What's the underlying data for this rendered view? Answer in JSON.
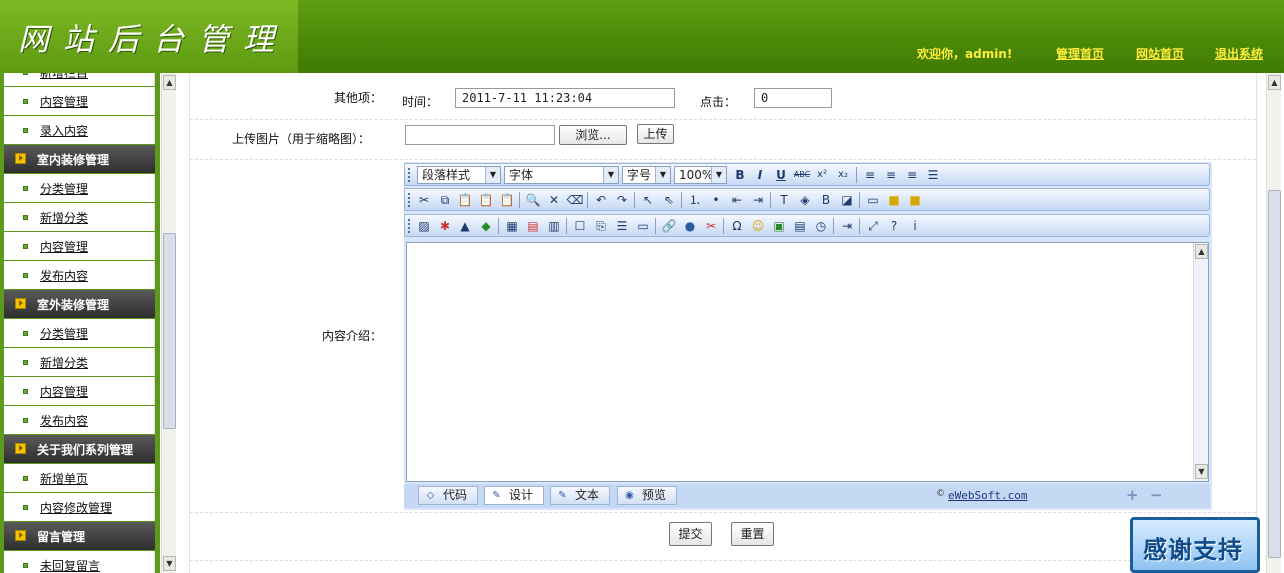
{
  "header": {
    "title": "网站后台管理",
    "welcome": "欢迎你，admin!",
    "links": [
      "管理首页",
      "网站首页",
      "退出系统"
    ]
  },
  "sidebar": {
    "items": [
      {
        "type": "item",
        "label": "新增栏目"
      },
      {
        "type": "item",
        "label": "内容管理"
      },
      {
        "type": "item",
        "label": "录入内容"
      },
      {
        "type": "head",
        "label": "室内装修管理"
      },
      {
        "type": "item",
        "label": "分类管理"
      },
      {
        "type": "item",
        "label": "新增分类"
      },
      {
        "type": "item",
        "label": "内容管理"
      },
      {
        "type": "item",
        "label": "发布内容"
      },
      {
        "type": "head",
        "label": "室外装修管理"
      },
      {
        "type": "item",
        "label": "分类管理"
      },
      {
        "type": "item",
        "label": "新增分类"
      },
      {
        "type": "item",
        "label": "内容管理"
      },
      {
        "type": "item",
        "label": "发布内容"
      },
      {
        "type": "head",
        "label": "关于我们系列管理"
      },
      {
        "type": "item",
        "label": "新增单页"
      },
      {
        "type": "item",
        "label": "内容修改管理"
      },
      {
        "type": "head",
        "label": "留言管理"
      },
      {
        "type": "item",
        "label": "未回复留言"
      }
    ]
  },
  "form": {
    "other_label": "其他项：",
    "time_label": "时间：",
    "time_value": "2011-7-11 11:23:04",
    "clicks_label": "点击：",
    "clicks_value": "0",
    "upload_label": "上传图片（用于缩略图）：",
    "browse_label": "浏览...",
    "upload_button": "上传",
    "content_label": "内容介绍：",
    "submit_label": "提交",
    "reset_label": "重置"
  },
  "editor": {
    "paragraph_style": "段落样式",
    "font": "字体",
    "font_size": "字号",
    "zoom": "100%",
    "mode_tabs": [
      "代码",
      "设计",
      "文本",
      "预览"
    ],
    "active_mode": "设计",
    "credit": "eWebSoft.com"
  },
  "badge": {
    "text": "感谢支持"
  },
  "colors": {
    "header_green": "#4b8a08",
    "link_yellow": "#ffeb3b",
    "sidebar_green": "#5b9a1a",
    "editor_blue": "#c6d9f4"
  }
}
